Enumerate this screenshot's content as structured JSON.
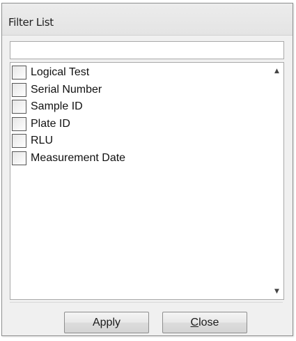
{
  "window": {
    "title": "Filter List"
  },
  "search": {
    "value": "",
    "placeholder": ""
  },
  "list": {
    "items": [
      {
        "label": "Logical Test",
        "checked": false
      },
      {
        "label": "Serial Number",
        "checked": false
      },
      {
        "label": "Sample ID",
        "checked": false
      },
      {
        "label": "Plate ID",
        "checked": false
      },
      {
        "label": "RLU",
        "checked": false
      },
      {
        "label": "Measurement Date",
        "checked": false
      }
    ]
  },
  "scrollbar": {
    "up_glyph": "▲",
    "down_glyph": "▼"
  },
  "buttons": {
    "apply_label": "Apply",
    "close_mnemonic": "C",
    "close_rest": "lose"
  },
  "colors": {
    "window_background": "#f0f0f0",
    "list_background": "#ffffff",
    "border": "#a9a9a9"
  }
}
